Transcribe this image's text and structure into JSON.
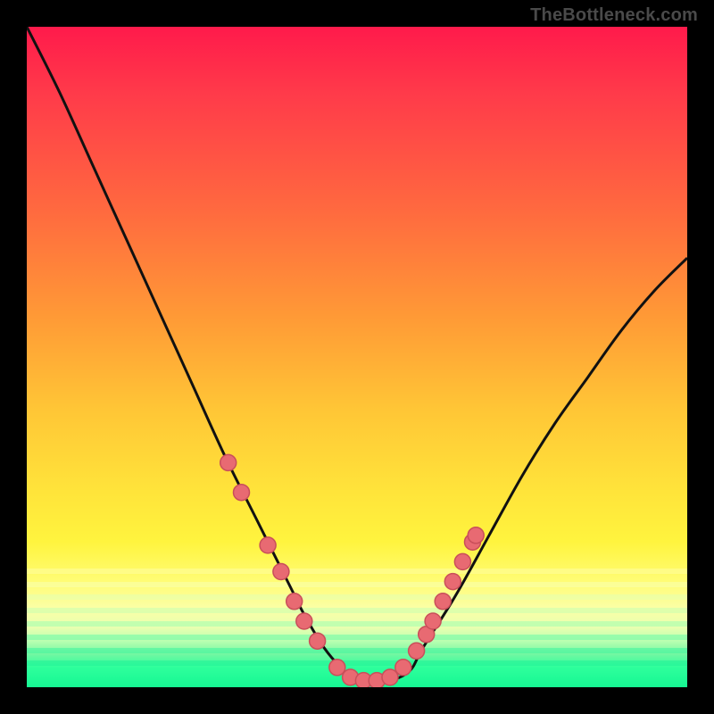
{
  "watermark": "TheBottleneck.com",
  "colors": {
    "frame": "#000000",
    "curve": "#111111",
    "dot_fill": "#e86a72",
    "dot_stroke": "#c94f5a"
  },
  "chart_data": {
    "type": "line",
    "title": "",
    "xlabel": "",
    "ylabel": "",
    "xlim": [
      0,
      100
    ],
    "ylim": [
      0,
      100
    ],
    "series": [
      {
        "name": "bottleneck-curve",
        "x": [
          0,
          5,
          10,
          15,
          20,
          25,
          30,
          35,
          40,
          42,
          45,
          48,
          50,
          52,
          55,
          58,
          60,
          65,
          70,
          75,
          80,
          85,
          90,
          95,
          100
        ],
        "y": [
          100,
          90,
          79,
          68,
          57,
          46,
          35,
          25,
          15,
          11,
          6,
          2.5,
          1,
          1,
          1,
          2.5,
          6,
          14,
          23,
          32,
          40,
          47,
          54,
          60,
          65
        ]
      }
    ],
    "markers": [
      {
        "x": 30.5,
        "y": 34
      },
      {
        "x": 32.5,
        "y": 29.5
      },
      {
        "x": 36.5,
        "y": 21.5
      },
      {
        "x": 38.5,
        "y": 17.5
      },
      {
        "x": 40.5,
        "y": 13
      },
      {
        "x": 42,
        "y": 10
      },
      {
        "x": 44,
        "y": 7
      },
      {
        "x": 47,
        "y": 3
      },
      {
        "x": 49,
        "y": 1.5
      },
      {
        "x": 51,
        "y": 1
      },
      {
        "x": 53,
        "y": 1
      },
      {
        "x": 55,
        "y": 1.5
      },
      {
        "x": 57,
        "y": 3
      },
      {
        "x": 59,
        "y": 5.5
      },
      {
        "x": 60.5,
        "y": 8
      },
      {
        "x": 61.5,
        "y": 10
      },
      {
        "x": 63,
        "y": 13
      },
      {
        "x": 64.5,
        "y": 16
      },
      {
        "x": 66,
        "y": 19
      },
      {
        "x": 67.5,
        "y": 22
      },
      {
        "x": 68,
        "y": 23
      }
    ],
    "stripes_y": [
      82,
      84,
      86,
      88,
      90,
      92,
      94,
      96
    ]
  }
}
